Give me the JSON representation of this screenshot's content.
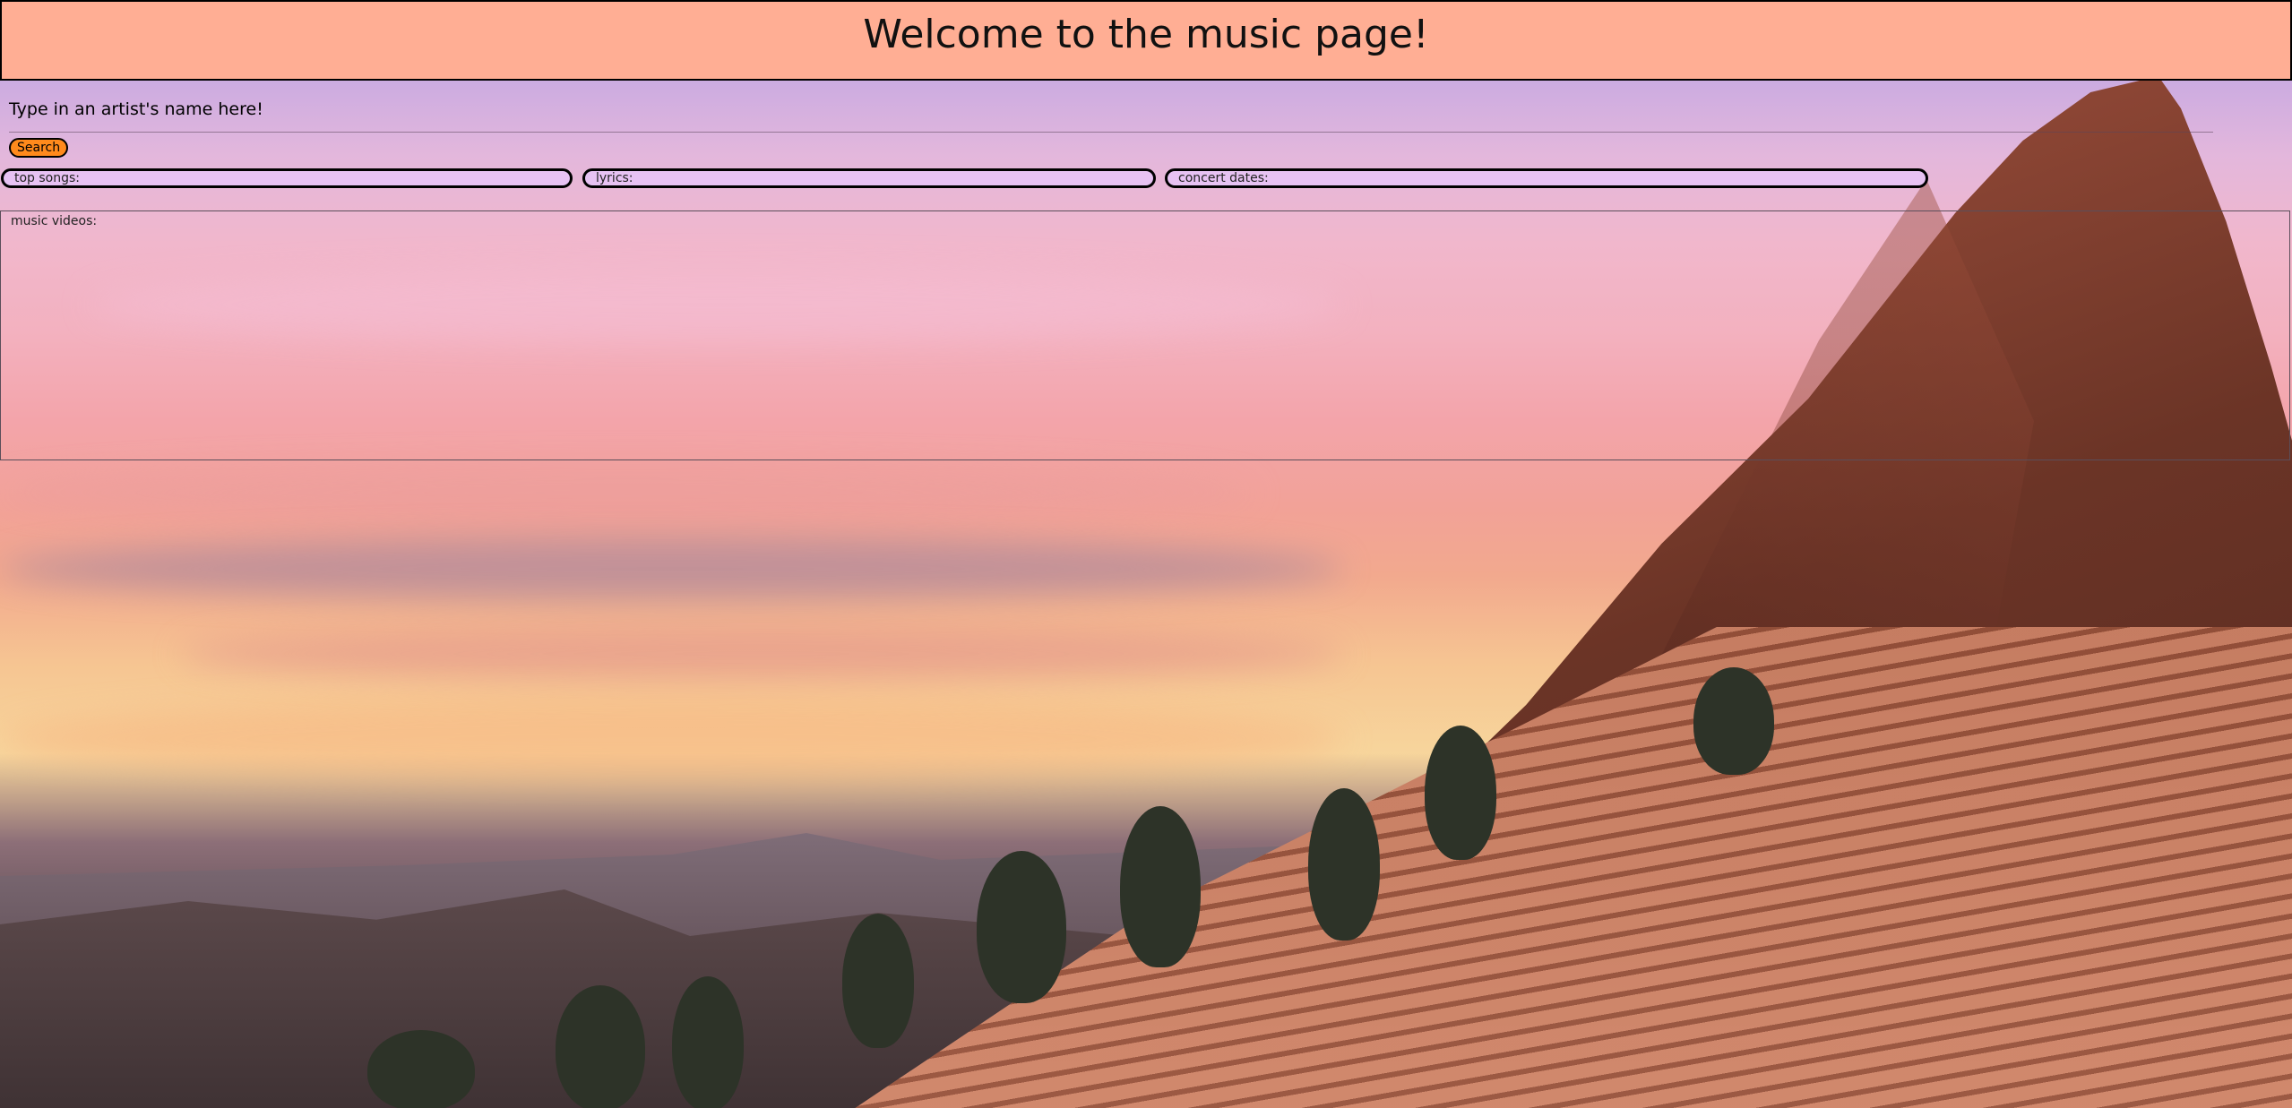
{
  "header": {
    "title": "Welcome to the music page!",
    "background_color": "#ffae94"
  },
  "search": {
    "prompt_label": "Type in an artist's name here!",
    "input_value": "",
    "button_label": "Search",
    "button_color": "#ff8a1c"
  },
  "results": {
    "top_songs_label": "top songs:",
    "lyrics_label": "lyrics:",
    "concert_dates_label": "concert dates:",
    "box_color": "#e7c2f3"
  },
  "videos": {
    "label": "music videos:"
  }
}
